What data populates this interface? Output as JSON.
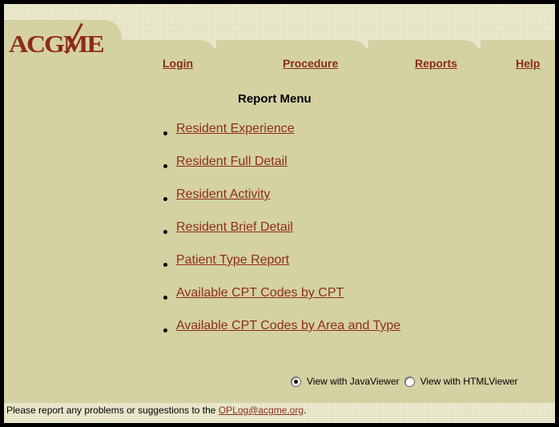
{
  "brand": {
    "logo_text": "ACGME"
  },
  "nav": {
    "login": "Login",
    "procedure": "Procedure",
    "reports": "Reports",
    "help": "Help"
  },
  "main": {
    "title": "Report Menu",
    "reports": [
      "Resident Experience",
      "Resident Full Detail",
      "Resident Activity",
      "Resident Brief Detail",
      "Patient Type Report",
      "Available CPT Codes by CPT",
      "Available CPT Codes by Area and Type"
    ]
  },
  "viewer_options": {
    "java_label": "View with JavaViewer",
    "html_label": "View with HTMLViewer",
    "selected": "java"
  },
  "footer": {
    "text": "Please report any problems or suggestions to the ",
    "email": "OPLog@acgme.org",
    "period": "."
  },
  "colors": {
    "background": "#d4d1a3",
    "link": "#8f2d1c",
    "brand": "#8f2a17"
  }
}
